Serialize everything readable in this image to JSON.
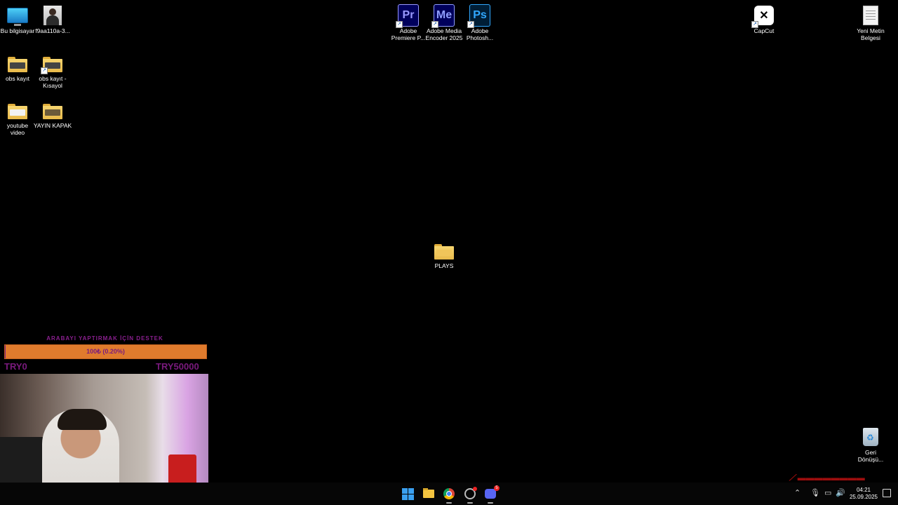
{
  "desktop": {
    "icons": {
      "this_pc": "Bu bilgisayar",
      "image_file": "f9aa110a-3...",
      "obs_folder": "obs kayıt",
      "obs_shortcut": "obs kayıt -\nKısayol",
      "youtube_folder": "youtube\nvideo",
      "yayin_folder": "YAYIN KAPAK",
      "premiere": "Adobe\nPremiere P...",
      "premiere_badge": "Pr",
      "media_encoder": "Adobe Media\nEncoder 2025",
      "media_encoder_badge": "Me",
      "photoshop": "Adobe\nPhotosh...",
      "photoshop_badge": "Ps",
      "capcut": "CapCut",
      "new_text": "Yeni Metin\nBelgesi",
      "plays": "PLAYS",
      "recycle_bin": "Geri\nDönüşü..."
    }
  },
  "overlay": {
    "title": "ARABAYI YAPTIRMAK İÇİN DESTEK",
    "progress_text": "100₺ (0.20%)",
    "progress_fraction": 0.002,
    "goal_min": "TRY0",
    "goal_max": "TRY50000"
  },
  "taskbar": {
    "time": "04:21",
    "date": "25.09.2025",
    "discord_badge": "5"
  },
  "colors": {
    "desktop": "#000000",
    "progress_bg": "#e07b2d",
    "progress_text": "#7a1a7e"
  }
}
